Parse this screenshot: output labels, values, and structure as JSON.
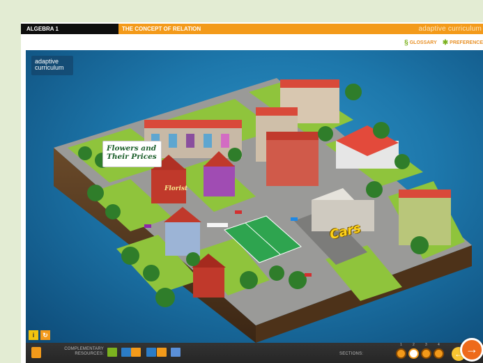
{
  "header": {
    "course": "ALGEBRA 1",
    "topic": "THE CONCEPT OF RELATION",
    "brand": "adaptive curriculum"
  },
  "toplinks": {
    "glossary": "GLOSSARY",
    "preferences": "PREFERENCE"
  },
  "scene": {
    "logo_line1": "adaptive",
    "logo_line2": "curriculum",
    "label_flowers": "Flowers and Their Prices",
    "florist_sign": "Florist",
    "cars_sign": "Cars"
  },
  "footer": {
    "complementary_line1": "COMPLEMENTARY",
    "complementary_line2": "RESOURCES:",
    "sections_label": "SECTIONS:",
    "section_numbers": [
      "1",
      "2",
      "3",
      "4"
    ],
    "active_section": 2
  },
  "colors": {
    "accent_orange": "#f39a1a",
    "title_black": "#0e0e0e",
    "scene_blue": "#1d77ab",
    "grass": "#8fc43c",
    "next_button": "#ee6a1b"
  },
  "icons": {
    "glossary": "glossary-icon",
    "preferences": "gear-icon",
    "info": "info-icon",
    "restart": "restart-icon",
    "home": "home-icon",
    "prev": "arrow-left-icon",
    "next": "arrow-right-icon"
  }
}
